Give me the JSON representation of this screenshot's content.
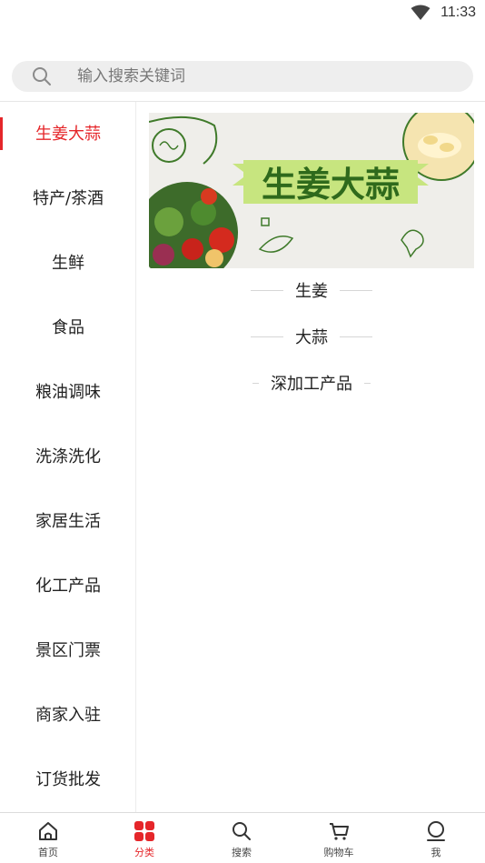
{
  "status_bar": {
    "time": "11:33",
    "wifi_icon": "wifi-icon"
  },
  "search": {
    "placeholder": "输入搜索关键词",
    "value": "",
    "icon": "search-icon"
  },
  "sidebar": {
    "items": [
      {
        "label": "生姜大蒜",
        "active": true
      },
      {
        "label": "特产/茶酒",
        "active": false
      },
      {
        "label": "生鲜",
        "active": false
      },
      {
        "label": "食品",
        "active": false
      },
      {
        "label": "粮油调味",
        "active": false
      },
      {
        "label": "洗涤洗化",
        "active": false
      },
      {
        "label": "家居生活",
        "active": false
      },
      {
        "label": "化工产品",
        "active": false
      },
      {
        "label": "景区门票",
        "active": false
      },
      {
        "label": "商家入驻",
        "active": false
      },
      {
        "label": "订货批发",
        "active": false
      }
    ]
  },
  "banner": {
    "title": "生姜大蒜"
  },
  "sub_categories": [
    "生姜",
    "大蒜",
    "深加工产品"
  ],
  "bottom_nav": {
    "items": [
      {
        "label": "首页",
        "icon": "home-icon",
        "active": false
      },
      {
        "label": "分类",
        "icon": "category-icon",
        "active": true
      },
      {
        "label": "搜索",
        "icon": "search-icon",
        "active": false
      },
      {
        "label": "购物车",
        "icon": "cart-icon",
        "active": false
      },
      {
        "label": "我",
        "icon": "user-icon",
        "active": false
      }
    ]
  },
  "colors": {
    "accent": "#e5262a",
    "banner_title": "#2f6a1c",
    "banner_ribbon": "#c7e57f"
  }
}
